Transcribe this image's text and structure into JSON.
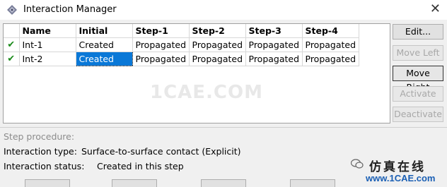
{
  "window": {
    "title": "Interaction Manager",
    "close_glyph": "✕"
  },
  "table": {
    "headers": [
      "",
      "Name",
      "Initial",
      "Step-1",
      "Step-2",
      "Step-3",
      "Step-4"
    ],
    "rows": [
      {
        "check": "✔",
        "name": "Int-1",
        "initial": "Created",
        "step1": "Propagated",
        "step2": "Propagated",
        "step3": "Propagated",
        "step4": "Propagated"
      },
      {
        "check": "✔",
        "name": "Int-2",
        "initial": "Created",
        "step1": "Propagated",
        "step2": "Propagated",
        "step3": "Propagated",
        "step4": "Propagated"
      }
    ],
    "selected_cell": "Int-2 / Initial"
  },
  "buttons": {
    "edit": "Edit...",
    "move_left": "Move Left",
    "move_right": "Move Right",
    "activate": "Activate",
    "deactivate": "Deactivate"
  },
  "info": {
    "step_procedure_label": "Step procedure:",
    "interaction_type_label": "Interaction type:",
    "interaction_type_value": "Surface-to-surface contact (Explicit)",
    "interaction_status_label": "Interaction status:",
    "interaction_status_value": "Created in this step"
  },
  "watermark": {
    "text": "1CAE.COM",
    "logo_cn": "仿真在线",
    "logo_url": "www.1CAE.com"
  },
  "colors": {
    "selection": "#0a78d7",
    "check": "#1a8a1a",
    "logo_url": "#1a5fb4"
  }
}
